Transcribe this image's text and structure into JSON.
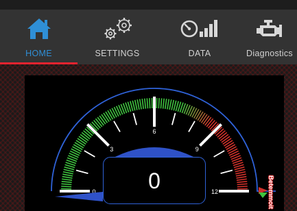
{
  "tabs": [
    {
      "label": "HOME",
      "icon": "home-icon",
      "active": true
    },
    {
      "label": "SETTINGS",
      "icon": "gears-icon",
      "active": false
    },
    {
      "label": "DATA",
      "icon": "gauge-bars-icon",
      "active": false
    },
    {
      "label": "Diagnostics",
      "icon": "engine-icon",
      "active": false
    }
  ],
  "gauge": {
    "min": 0,
    "max": 12,
    "tick_labels": [
      "0",
      "3",
      "6",
      "9",
      "12"
    ],
    "value": 0,
    "readout": "0",
    "side_label": "Betemmoit"
  },
  "colors": {
    "accent_blue": "#2f8fd6",
    "active_underline": "#e5232f",
    "gauge_outline": "#2f62d8",
    "scale_green": "#3fc43f",
    "scale_red": "#d0302a"
  }
}
